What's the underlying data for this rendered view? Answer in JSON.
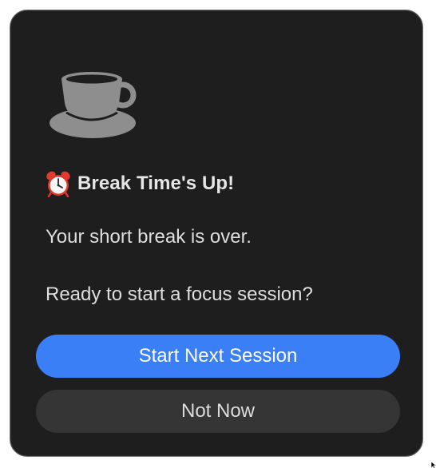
{
  "dialog": {
    "title_emoji_icon": "alarm-clock-icon",
    "app_icon": "coffee-cup-icon",
    "title": "Break Time's Up!",
    "message_line1": "Your short break is over.",
    "message_line2": "Ready to start a focus session?"
  },
  "buttons": {
    "primary_label": "Start Next Session",
    "secondary_label": "Not Now"
  },
  "colors": {
    "dialog_background": "#1e1e1e",
    "primary_button": "#3a7ff6",
    "secondary_button": "#353535",
    "icon_gray": "#8e8e8e"
  }
}
